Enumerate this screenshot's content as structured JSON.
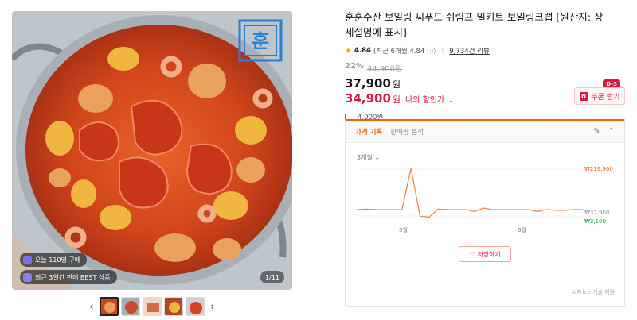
{
  "product": {
    "title": "훈훈수산 보일링 씨푸드 쉬림프 밀키트 보일링크랩 [원산지: 상세설명에 표시]",
    "rating": "4.84",
    "rating_detail": "(최근 6개월 4.84",
    "reviews": "9,734건 리뷰",
    "discount_pct": "22%",
    "original_price": "44,900원",
    "price": "37,900",
    "price_unit": "원",
    "sale_price": "34,900",
    "sale_unit": "원",
    "sale_label": "나의 할인가",
    "coupon_label": "쿠폰 받기",
    "coupon_badge": "N",
    "dday": "D-3",
    "shipping": "4,000원"
  },
  "image": {
    "badge_today": "오늘 110명 구매",
    "badge_best": "최근 3일간 판매 BEST 상품",
    "counter": "1/11",
    "logo_text": "훈"
  },
  "thumbnails": [
    "thumb-1",
    "thumb-2",
    "thumb-3",
    "thumb-4",
    "thumb-5"
  ],
  "price_panel": {
    "tab_active": "가격 기록",
    "tab_inactive": "판매량 분석",
    "period": "3개월 ⌄",
    "save_label": "저장하기",
    "credit": "AiPrice 기술 지원",
    "max_label": "₩219,900",
    "cur_label": "₩37,900",
    "min_label": "₩3,100",
    "x_labels": [
      "5월",
      "6월"
    ]
  },
  "colors": {
    "accent": "#ff5a00",
    "sale": "#e5143c",
    "line": "#f08a4b"
  },
  "chart_data": {
    "type": "line",
    "series": [
      {
        "values": [
          37900,
          40000,
          37900,
          37900,
          37900,
          37900,
          219900,
          9000,
          5000,
          40000,
          37900,
          37900,
          37900,
          30000,
          45000,
          37900,
          37900,
          37900,
          37900,
          37900,
          30000,
          37900,
          35000,
          35000,
          37900,
          37900
        ]
      }
    ],
    "x": [
      "",
      "",
      "",
      "",
      "",
      "5월",
      "",
      "",
      "",
      "",
      "",
      "",
      "",
      "",
      "",
      "",
      "",
      "6월",
      "",
      "",
      "",
      "",
      "",
      "",
      "",
      ""
    ],
    "annotations": [
      "₩219,900",
      "₩37,900",
      "₩3,100"
    ],
    "ylim": [
      3100,
      219900
    ]
  }
}
